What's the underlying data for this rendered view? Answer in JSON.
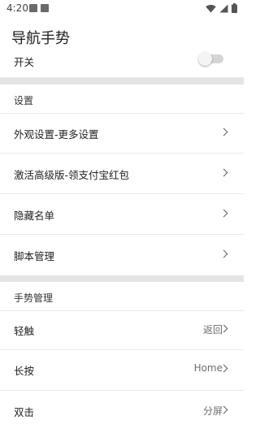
{
  "status_bar": {
    "time": "4:20",
    "icons": [
      "gallery-notification-icon",
      "text-notification-icon",
      "wifi-icon",
      "cellular-signal-icon",
      "battery-icon"
    ]
  },
  "app": {
    "title": "导航手势"
  },
  "switch_row": {
    "label": "开关",
    "on": false
  },
  "settings_section": {
    "header": "设置",
    "items": [
      {
        "label": "外观设置-更多设置"
      },
      {
        "label": "激活高级版-领支付宝红包"
      },
      {
        "label": "隐藏名单"
      },
      {
        "label": "脚本管理"
      }
    ]
  },
  "gesture_section": {
    "header": "手势管理",
    "items": [
      {
        "label": "轻触",
        "value": "返回"
      },
      {
        "label": "长按",
        "value": "Home"
      },
      {
        "label": "双击",
        "value": "分屏"
      }
    ]
  }
}
